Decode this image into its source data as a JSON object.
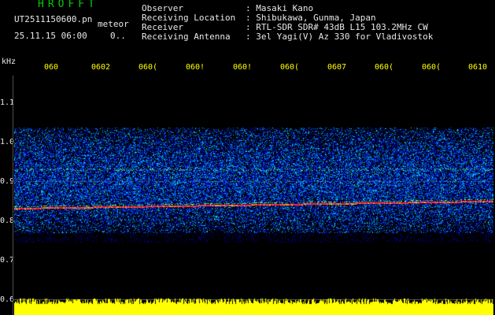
{
  "header": {
    "app_title": "HROFFT",
    "file_name": "UT2511150600.pn",
    "mode": "meteor",
    "date_time": "25.11.15 06:00",
    "extra": "0.."
  },
  "info": [
    {
      "label": "Observer",
      "value": ": Masaki Kano"
    },
    {
      "label": "Receiving Location",
      "value": ": Shibukawa, Gunma, Japan"
    },
    {
      "label": "Receiver",
      "value": ": RTL-SDR SDR# 43dB L15 103.2MHz CW"
    },
    {
      "label": "Receiving Antenna",
      "value": ": 3el Yagi(V) Az 330 for Vladivostok"
    }
  ],
  "axis": {
    "unit": "kHz",
    "x_ticks": [
      "060",
      "0602",
      "060(",
      "060!",
      "060!",
      "060(",
      "0607",
      "060(",
      "060(",
      "0610"
    ],
    "y_ticks": [
      "1.1",
      "1.0",
      "0.9",
      "0.8",
      "0.7",
      "0.6"
    ]
  },
  "colors": {
    "background": "#000000",
    "noise_low": "#0000a0",
    "noise_mid": "#00a0ff",
    "signal_line": "#ff2040",
    "level_bar": "#ffff00"
  }
}
